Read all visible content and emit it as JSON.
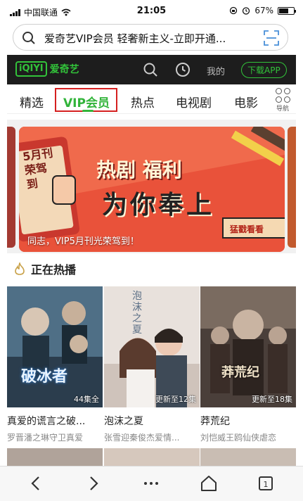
{
  "status_bar": {
    "carrier": "中国联通",
    "time": "21:05",
    "battery": "67%",
    "battery_level": 0.67
  },
  "address_bar": {
    "text": "爱奇艺VIP会员 轻奢新主义-立即开通..."
  },
  "header": {
    "brand": "爱奇艺",
    "logo_text": "iQIYI",
    "mine_label": "我的",
    "download_label": "下载APP"
  },
  "tabs": [
    {
      "label": "精选"
    },
    {
      "label": "VIP会员",
      "active": true
    },
    {
      "label": "热点"
    },
    {
      "label": "电视剧"
    },
    {
      "label": "电影"
    }
  ],
  "nav_label": "导航",
  "banner": {
    "corner_text": "5月刊荣驾到",
    "headline_1": "热剧 福利",
    "headline_2": "为你奉上",
    "stamp": "猛戳看看",
    "caption": "同志，VIP5月刊光荣驾到！"
  },
  "section": {
    "title": "正在热播"
  },
  "cards": [
    {
      "poster_text": "破冰者",
      "badge": "44集全",
      "title": "真爱的谎言之破...",
      "subtitle": "罗晋潘之琳守卫真爱"
    },
    {
      "poster_text": "泡沫之夏",
      "badge": "更新至12集",
      "title": "泡沫之夏",
      "subtitle": "张雪迎秦俊杰爱情..."
    },
    {
      "poster_text": "莽荒纪",
      "badge": "更新至18集",
      "title": "莽荒纪",
      "subtitle": "刘恺威王鸥仙侠虐恋"
    }
  ],
  "colors": {
    "brand_green": "#32c33a",
    "header_bg": "#1d1d1d",
    "highlight_red": "#d51f1f"
  }
}
